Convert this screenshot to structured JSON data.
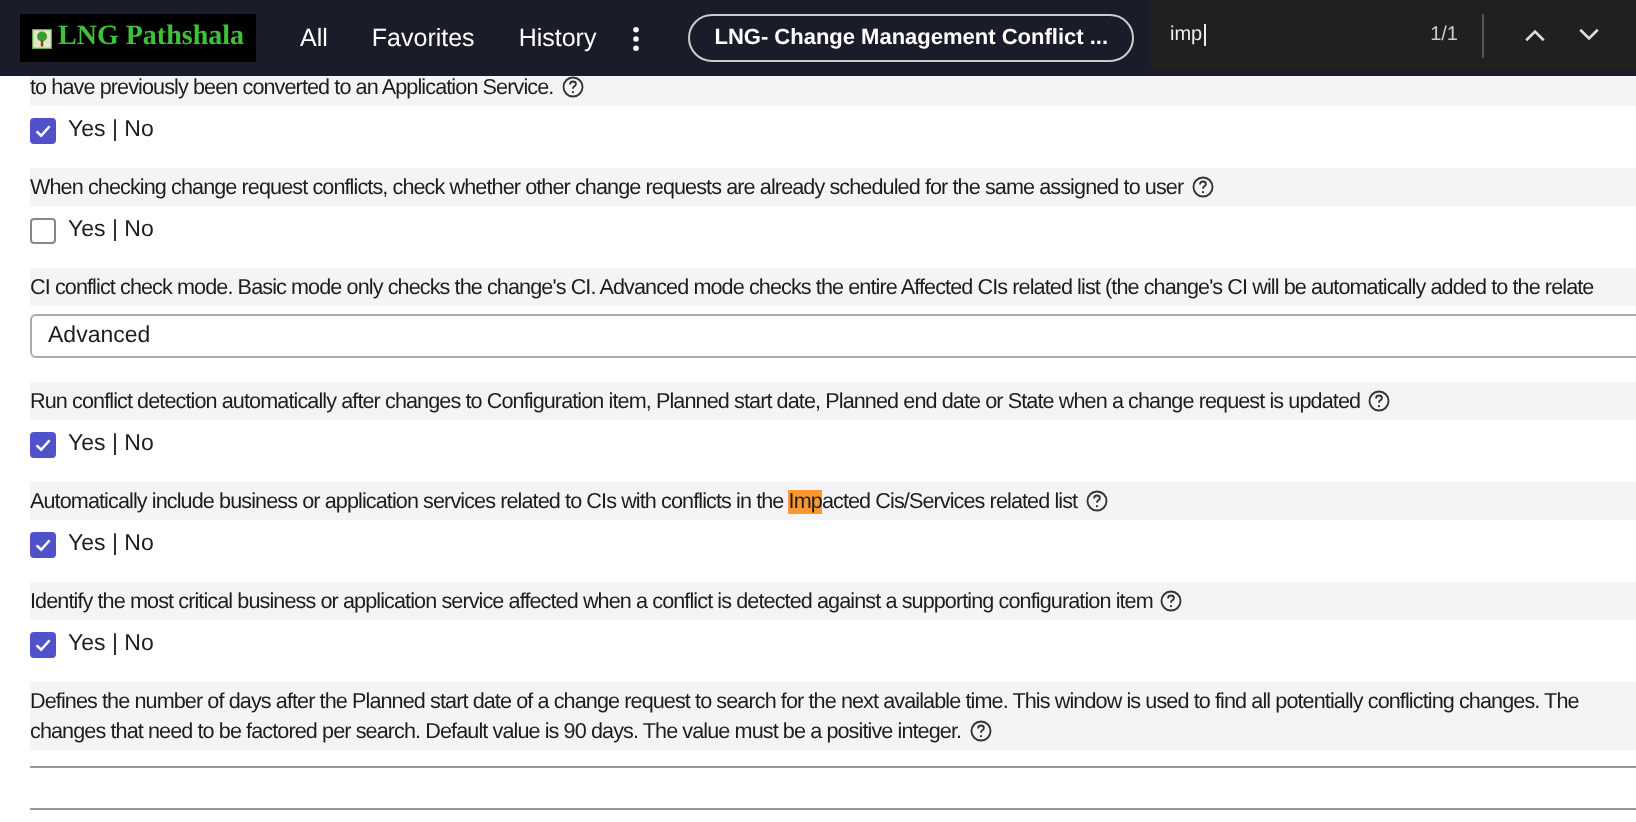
{
  "header": {
    "logo": "LNG Pathshala",
    "nav": [
      {
        "label": "All"
      },
      {
        "label": "Favorites"
      },
      {
        "label": "History"
      }
    ],
    "tab_title": "LNG- Change Management Conflict ..."
  },
  "find_bar": {
    "value": "imp",
    "count": "1/1"
  },
  "properties": [
    {
      "kind": "checkbox",
      "label": [
        [
          {
            "text": "to have previously been converted to an Application Service.",
            "highlighted": false
          }
        ]
      ],
      "help": true,
      "option": "Yes | No",
      "checked": true
    },
    {
      "kind": "checkbox",
      "label": [
        [
          {
            "text": "When checking change request conflicts, check whether other change requests are already scheduled for the same assigned to user",
            "highlighted": false
          }
        ]
      ],
      "help": true,
      "option": "Yes | No",
      "checked": false
    },
    {
      "kind": "select",
      "label": [
        [
          {
            "text": "CI conflict check mode. Basic mode only checks the change's CI. Advanced mode checks the entire Affected CIs related list (the change's CI will be automatically added to the relate",
            "highlighted": false
          }
        ]
      ],
      "help": false,
      "value": "Advanced"
    },
    {
      "kind": "checkbox",
      "label": [
        [
          {
            "text": "Run conflict detection automatically after changes to Configuration item, Planned start date, Planned end date or State when a change request is updated",
            "highlighted": false
          }
        ]
      ],
      "help": true,
      "option": "Yes | No",
      "checked": true
    },
    {
      "kind": "checkbox",
      "label": [
        [
          {
            "text": "Automatically include business or application services related to CIs with conflicts in the ",
            "highlighted": false
          },
          {
            "text": "Imp",
            "highlighted": true
          },
          {
            "text": "acted Cis/Services related list",
            "highlighted": false
          }
        ]
      ],
      "help": true,
      "option": "Yes | No",
      "checked": true
    },
    {
      "kind": "checkbox",
      "label": [
        [
          {
            "text": "Identify the most critical business or application service affected when a conflict is detected against a supporting configuration item",
            "highlighted": false
          }
        ]
      ],
      "help": true,
      "option": "Yes | No",
      "checked": true
    },
    {
      "kind": "text",
      "label": [
        [
          {
            "text": "Defines the number of days after the Planned start date of a change request to search for the next available time. This window is used to find all potentially conflicting changes. The",
            "highlighted": false
          }
        ],
        [
          {
            "text": "changes that need to be factored per search. Default value is 90 days. The value must be a positive integer.",
            "highlighted": false
          }
        ]
      ],
      "help": true
    }
  ]
}
